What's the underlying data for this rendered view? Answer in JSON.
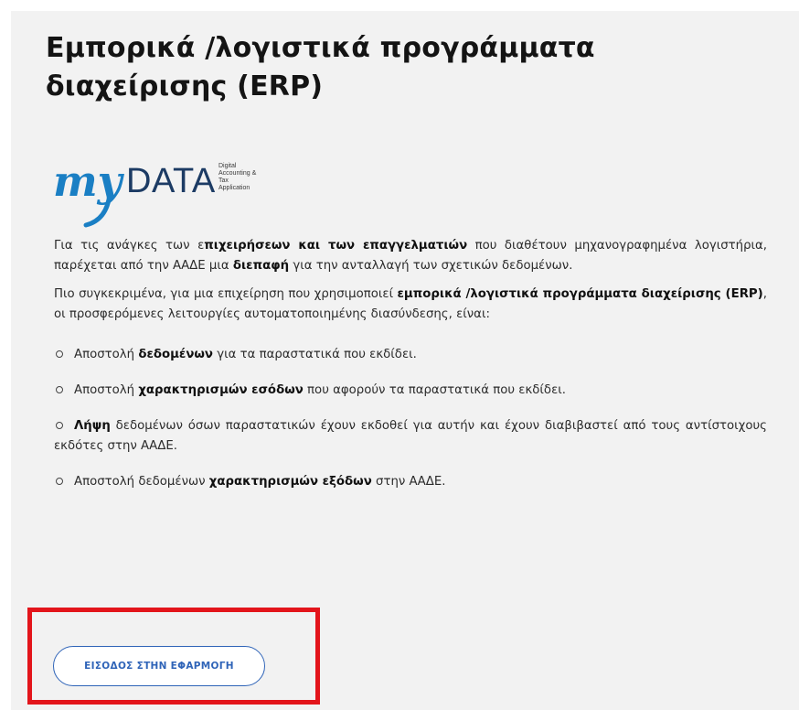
{
  "page": {
    "title": "Εμπορικά /λογιστικά προγράμματα διαχείρισης (ERP)"
  },
  "logo": {
    "wordmark_my": "my",
    "wordmark_data": "DATA",
    "subtitle_lines": [
      "Digital",
      "Accounting &",
      "Tax",
      "Application"
    ],
    "colors": {
      "my": "#1a7fc4",
      "data": "#1c3b64"
    }
  },
  "intro": {
    "p1": [
      {
        "t": "Για τις ανάγκες των ε",
        "b": false
      },
      {
        "t": "πιχειρήσεων και των επαγγελματιών",
        "b": true
      },
      {
        "t": " που διαθέτουν μηχανογραφημένα λογιστήρια, παρέχεται από την ΑΑΔΕ μια ",
        "b": false
      },
      {
        "t": "διεπαφή",
        "b": true
      },
      {
        "t": " για την ανταλλαγή των σχετικών δεδομένων.",
        "b": false
      }
    ],
    "p2": [
      {
        "t": "Πιο συγκεκριμένα, για μια επιχείρηση που χρησιμοποιεί ",
        "b": false
      },
      {
        "t": "εμπορικά /λογιστικά προγράμματα διαχείρισης (ERP)",
        "b": true
      },
      {
        "t": ", οι προσφερόμενες λειτουργίες αυτοματοποιημένης διασύνδεσης, είναι:",
        "b": false
      }
    ]
  },
  "features": [
    [
      {
        "t": "Αποστολή ",
        "b": false
      },
      {
        "t": "δεδομένων",
        "b": true
      },
      {
        "t": " για τα παραστατικά που εκδίδει.",
        "b": false
      }
    ],
    [
      {
        "t": "Αποστολή ",
        "b": false
      },
      {
        "t": "χαρακτηρισμών εσόδων",
        "b": true
      },
      {
        "t": " που αφορούν τα παραστατικά που εκδίδει.",
        "b": false
      }
    ],
    [
      {
        "t": "Λήψη",
        "b": true
      },
      {
        "t": " δεδομένων όσων παραστατικών έχουν εκδοθεί για αυτήν και έχουν διαβιβαστεί από τους αντίστοιχους εκδότες στην ΑΑΔΕ.",
        "b": false
      }
    ],
    [
      {
        "t": "Αποστολή δεδομένων ",
        "b": false
      },
      {
        "t": "χαρακτηρισμών εξόδων",
        "b": true
      },
      {
        "t": " στην ΑΑΔΕ.",
        "b": false
      }
    ]
  ],
  "action": {
    "entry_button_label": "ΕΙΣΟΔΟΣ ΣΤΗΝ ΕΦΑΡΜΟΓΗ"
  },
  "colors": {
    "panel_bg": "#f2f2f2",
    "highlight_border": "#e3151b",
    "button_accent": "#2f64b8"
  }
}
